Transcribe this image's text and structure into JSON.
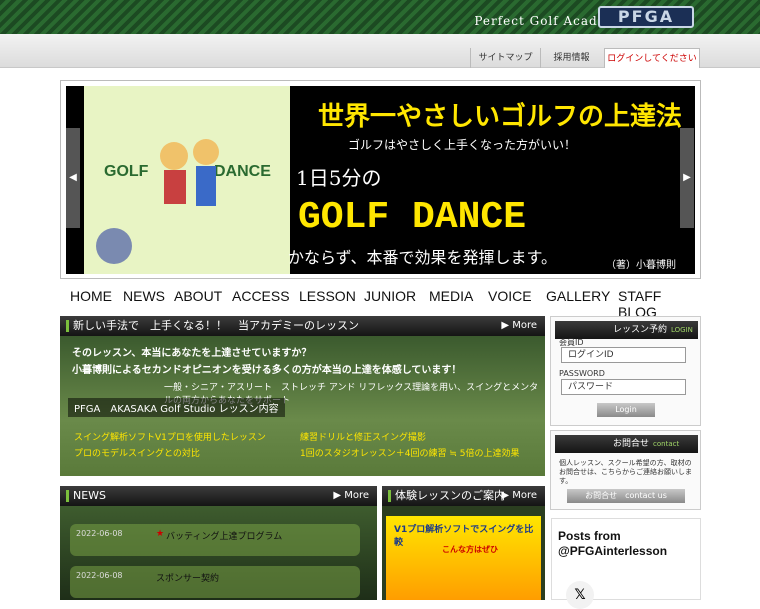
{
  "header": {
    "brand": "Perfect Golf Academy",
    "logo": "PFGA"
  },
  "utility_tabs": [
    {
      "label": "サイトマップ"
    },
    {
      "label": "採用情報"
    },
    {
      "label": "ログインしてください"
    }
  ],
  "slider": {
    "title": "世界一やさしいゴルフの上達法",
    "subtitle": "ゴルフはやさしく上手くなった方がいい！",
    "one_day": "1日5分の",
    "golf_dance": "GOLF DANCE",
    "tagline": "かならず、本番で効果を発揮します。",
    "author": "（著）小暮博則",
    "prev": "◀",
    "next": "▶"
  },
  "nav": [
    {
      "label": "HOME"
    },
    {
      "label": "NEWS"
    },
    {
      "label": "ABOUT"
    },
    {
      "label": "ACCESS"
    },
    {
      "label": "LESSON"
    },
    {
      "label": "JUNIOR"
    },
    {
      "label": "MEDIA"
    },
    {
      "label": "VOICE"
    },
    {
      "label": "GALLERY"
    },
    {
      "label": "STAFF BLOG"
    }
  ],
  "lesson": {
    "header": "新しい手法で　上手くなる！！　当アカデミーのレッスン",
    "more": "▶ More",
    "line1": "そのレッスン、本当にあなたを上達させていますか？",
    "line2": "小暮博則によるセカンドオピニオンを受ける多くの方が本当の上達を体感しています！",
    "line3": "一般・シニア・アスリート　ストレッチ アンド リフレックス理論を用い、スイングとメンタルの両方からあなたをサポート",
    "line4": "PFGA　AKASAKA Golf Studio レッスン内容",
    "bullets": [
      "スイング解析ソフトV1プロを使用したレッスン",
      "練習ドリルと修正スイング撮影",
      "プロのモデルスイングとの対比",
      "1回のスタジオレッスン＋4回の練習 ≒ 5倍の上達効果"
    ]
  },
  "login": {
    "title": "レッスン予約",
    "sub": "LOGIN",
    "id_label": "会員ID",
    "id_placeholder": "ログインID",
    "pw_label": "PASSWORD",
    "pw_placeholder": "パスワード",
    "button": "Login"
  },
  "contact": {
    "title": "お問合せ",
    "sub": "contact",
    "text": "個人レッスン、スクール希望の方、取材のお問合せは、こちらからご連絡お願いします。",
    "button": "お問合せ　contact us"
  },
  "news": {
    "header": "NEWS",
    "more": "▶ More",
    "items": [
      {
        "date": "2022-06-08",
        "title": "バッティング上達プログラム",
        "star": "★"
      },
      {
        "date": "2022-06-08",
        "title": "スポンサー契約",
        "star": ""
      }
    ]
  },
  "trial": {
    "header": "体験レッスンのご案内",
    "more": "▶ More",
    "banner": "V1プロ解析ソフトでスイングを比較",
    "banner2": "こんな方はぜひ"
  },
  "posts": {
    "title": "Posts from @PFGAinterlesson",
    "x_icon": "x-logo-icon"
  }
}
